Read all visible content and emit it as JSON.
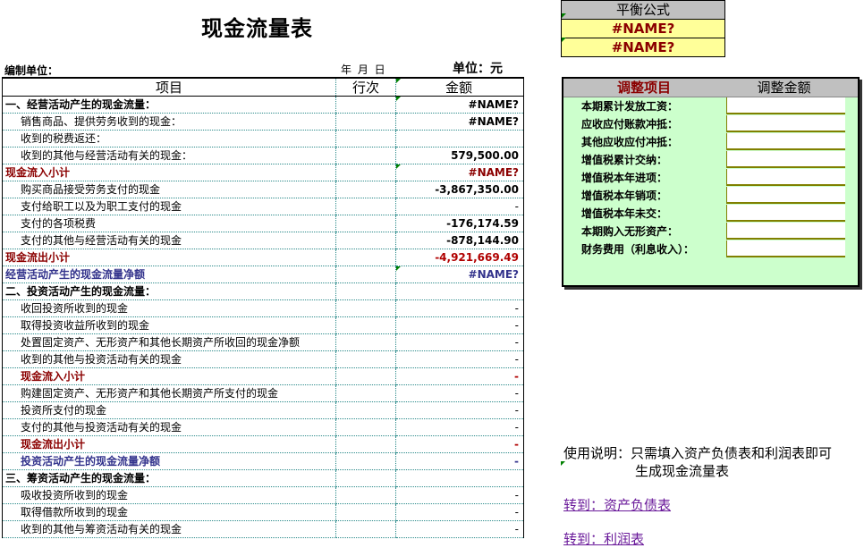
{
  "title": "现金流量表",
  "meta": {
    "unit_label": "编制单位：",
    "date_label": "年 月 日",
    "currency_label": "单位：元"
  },
  "table": {
    "headers": [
      "项目",
      "行次",
      "金额"
    ],
    "rows": [
      {
        "item": "一、经营活动产生的现金流量：",
        "line": "",
        "amount": "#NAME?",
        "style": "bold"
      },
      {
        "item": "销售商品、提供劳务收到的现金：",
        "line": "",
        "amount": "#NAME?",
        "style": "ind"
      },
      {
        "item": "收到的税费返还：",
        "line": "",
        "amount": "",
        "style": "ind"
      },
      {
        "item": "收到的其他与经营活动有关的现金：",
        "line": "",
        "amount": "579,500.00",
        "style": "ind"
      },
      {
        "item": "现金流入小计",
        "line": "",
        "amount": "#NAME?",
        "style": "red"
      },
      {
        "item": "购买商品接受劳务支付的现金",
        "line": "",
        "amount": "-3,867,350.00",
        "style": "ind"
      },
      {
        "item": "支付给职工以及为职工支付的现金",
        "line": "",
        "amount": "-",
        "style": "ind"
      },
      {
        "item": "支付的各项税费",
        "line": "",
        "amount": "-176,174.59",
        "style": "ind"
      },
      {
        "item": "支付的其他与经营活动有关的现金",
        "line": "",
        "amount": "-878,144.90",
        "style": "ind"
      },
      {
        "item": "现金流出小计",
        "line": "",
        "amount": "-4,921,669.49",
        "style": "red"
      },
      {
        "item": "经营活动产生的现金流量净额",
        "line": "",
        "amount": "#NAME?",
        "style": "blue"
      },
      {
        "item": "二、投资活动产生的现金流量：",
        "line": "",
        "amount": "",
        "style": "bold"
      },
      {
        "item": "收回投资所收到的现金",
        "line": "",
        "amount": "-",
        "style": "ind"
      },
      {
        "item": "取得投资收益所收到的现金",
        "line": "",
        "amount": "-",
        "style": "ind"
      },
      {
        "item": "处置固定资产、无形资产和其他长期资产所收回的现金净额",
        "line": "",
        "amount": "-",
        "style": "ind"
      },
      {
        "item": "收到的其他与投资活动有关的现金",
        "line": "",
        "amount": "-",
        "style": "ind"
      },
      {
        "item": "现金流入小计",
        "line": "",
        "amount": "-",
        "style": "red-ind"
      },
      {
        "item": "购建固定资产、无形资产和其他长期资产所支付的现金",
        "line": "",
        "amount": "-",
        "style": "ind"
      },
      {
        "item": "投资所支付的现金",
        "line": "",
        "amount": "-",
        "style": "ind"
      },
      {
        "item": "支付的其他与投资活动有关的现金",
        "line": "",
        "amount": "-",
        "style": "ind"
      },
      {
        "item": "现金流出小计",
        "line": "",
        "amount": "-",
        "style": "red-ind"
      },
      {
        "item": "投资活动产生的现金流量净额",
        "line": "",
        "amount": "-",
        "style": "blue-ind"
      },
      {
        "item": "三、筹资活动产生的现金流量：",
        "line": "",
        "amount": "",
        "style": "bold"
      },
      {
        "item": "吸收投资所收到的现金",
        "line": "",
        "amount": "-",
        "style": "ind"
      },
      {
        "item": "取得借款所收到的现金",
        "line": "",
        "amount": "-",
        "style": "ind"
      },
      {
        "item": "收到的其他与筹资活动有关的现金",
        "line": "",
        "amount": "-",
        "style": "ind"
      }
    ]
  },
  "balance": {
    "title": "平衡公式",
    "values": [
      "#NAME?",
      "#NAME?"
    ]
  },
  "adjust": {
    "header_item": "调整项目",
    "header_amount": "调整金额",
    "items": [
      "本期累计发放工资：",
      "应收应付账款冲抵：",
      "其他应收应付冲抵：",
      "增值税累计交纳：",
      "增值税本年进项：",
      "增值税本年销项：",
      "增值税本年未交：",
      "本期购入无形资产：",
      "财务费用（利息收入）："
    ]
  },
  "instructions": {
    "label": "使用说明：",
    "line1": "只需填入资产负债表和利润表即可",
    "line2": "生成现金流量表"
  },
  "links": {
    "balance_sheet": "转到：资产负债表",
    "income_statement": "转到：利润表"
  },
  "colors": {
    "grid": "#2a8a8a",
    "subtotal_red": "#8b0000",
    "net_blue": "#33338c",
    "panel_green": "#ccffcc",
    "formula_yellow": "#ffff99",
    "header_gray": "#c0c0c0"
  }
}
